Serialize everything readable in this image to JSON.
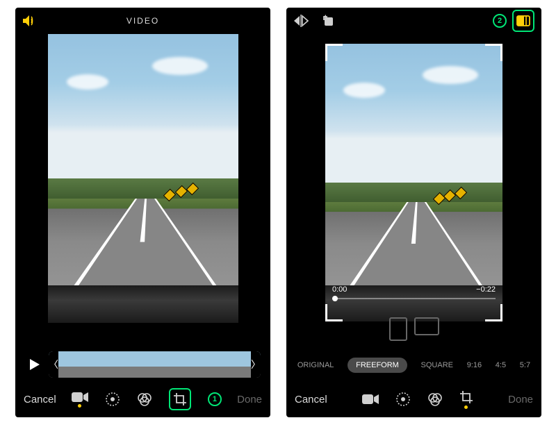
{
  "left": {
    "header_title": "VIDEO",
    "cancel": "Cancel",
    "done": "Done",
    "badge": "1"
  },
  "right": {
    "time_start": "0:00",
    "time_end": "−0:22",
    "cancel": "Cancel",
    "done": "Done",
    "badge": "2",
    "aspect": {
      "original": "ORIGINAL",
      "freeform": "FREEFORM",
      "square": "SQUARE",
      "r916": "9:16",
      "r45": "4:5",
      "r57": "5:7"
    }
  }
}
